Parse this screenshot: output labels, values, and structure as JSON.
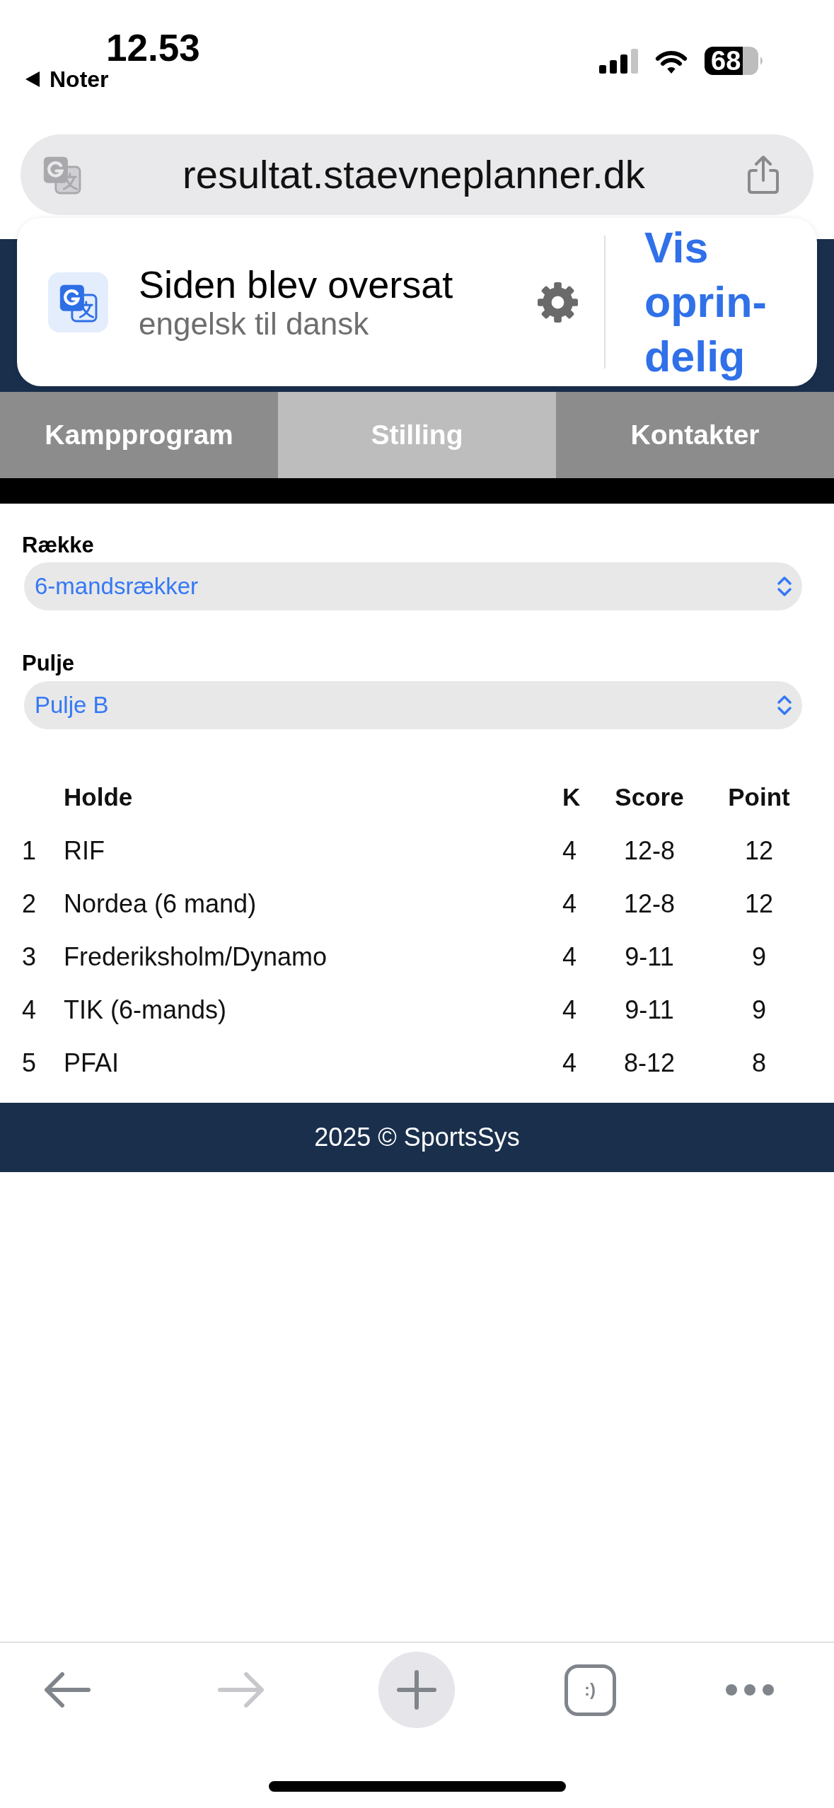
{
  "status_bar": {
    "time": "12.53",
    "back_app": "Noter",
    "battery": "68"
  },
  "address_bar": {
    "url": "resultat.staevneplanner.dk"
  },
  "translate_banner": {
    "title": "Siden blev oversat",
    "subtitle": "engelsk til dansk",
    "action": "Vis oprin-delig"
  },
  "tabs": [
    {
      "label": "Kampprogram",
      "selected": false
    },
    {
      "label": "Stilling",
      "selected": true
    },
    {
      "label": "Kontakter",
      "selected": false
    }
  ],
  "filters": [
    {
      "label": "Række",
      "value": "6-mandsrækker"
    },
    {
      "label": "Pulje",
      "value": "Pulje B"
    }
  ],
  "table": {
    "columns": [
      "Holde",
      "K",
      "Score",
      "Point"
    ],
    "rows": [
      {
        "column_1": "1",
        "holde": "RIF",
        "k": "4",
        "score": "12-8",
        "point": "12"
      },
      {
        "column_1": "2",
        "holde": "Nordea (6 mand)",
        "k": "4",
        "score": "12-8",
        "point": "12"
      },
      {
        "column_1": "3",
        "holde": "Frederiksholm/Dynamo",
        "k": "4",
        "score": "9-11",
        "point": "9"
      },
      {
        "column_1": "4",
        "holde": "TIK (6-mands)",
        "k": "4",
        "score": "9-11",
        "point": "9"
      },
      {
        "column_1": "5",
        "holde": "PFAI",
        "k": "4",
        "score": "8-12",
        "point": "8"
      }
    ]
  },
  "footer": {
    "text": "2025 © SportsSys"
  },
  "toolbar": [
    {
      "kind": "back",
      "disabled": false
    },
    {
      "kind": "forward",
      "disabled": true
    },
    {
      "kind": "new_tab",
      "disabled": false
    },
    {
      "kind": "tabs",
      "label": ":)",
      "disabled": false
    },
    {
      "kind": "menu",
      "disabled": false
    }
  ]
}
